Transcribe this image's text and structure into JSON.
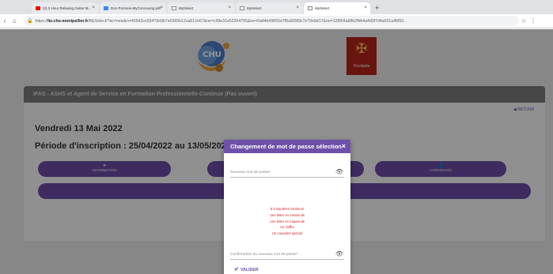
{
  "browser": {
    "tabs": [
      {
        "label": "(2) 3 Hour Relaxing Guitar M...",
        "favicon": "youtube-icon"
      },
      {
        "label": "Doc-Pormeis-MyConcoursp.pdf",
        "favicon": "doc-icon"
      },
      {
        "label": "MySelect",
        "favicon": "doc-icon"
      },
      {
        "label": "MySelect",
        "favicon": "doc-icon"
      },
      {
        "label": "MySelect",
        "favicon": "doc-icon"
      }
    ],
    "new_tab": "+",
    "url_prefix": "https://",
    "url_domain": "lte.chu-montpellier.fr",
    "url_rest": "/MySelect/?ac=new&n=405d3ce55478e8b7e5365b12ca812e67&ne=c98e31e52204755&ne=0a84b49855d7f8a5f289c7e79efaf17&no=1285f4a88b2fbb4a4d3f7d4a531a4fd50..."
  },
  "page": {
    "logo_chu_text": "CHU",
    "logo_region_text": "Occitanie",
    "offer_title": "IFAS - ASHS et Agent de Service en Formation Professionnelle Continue (Pas ouvert)",
    "retour": "RETOUR",
    "date_title": "Vendredi 13 Mai 2022",
    "period": "Période d'inscription : 25/04/2022 au 13/05/2022",
    "btn_information": "INFORMATION",
    "btn_connexion": "CONNEXION"
  },
  "modal": {
    "title": "Changement de mot de passe sélection",
    "new_password_label": "Nouveau mot de passe*",
    "rules": [
      "8 Caractères minimum",
      "Une lettre en minuscule",
      "Une lettre en majuscule",
      "Un chiffre",
      "Un caractère spécial"
    ],
    "confirm_label": "Confirmation du nouveau mot de passe*",
    "validate_label": "VALIDER"
  }
}
